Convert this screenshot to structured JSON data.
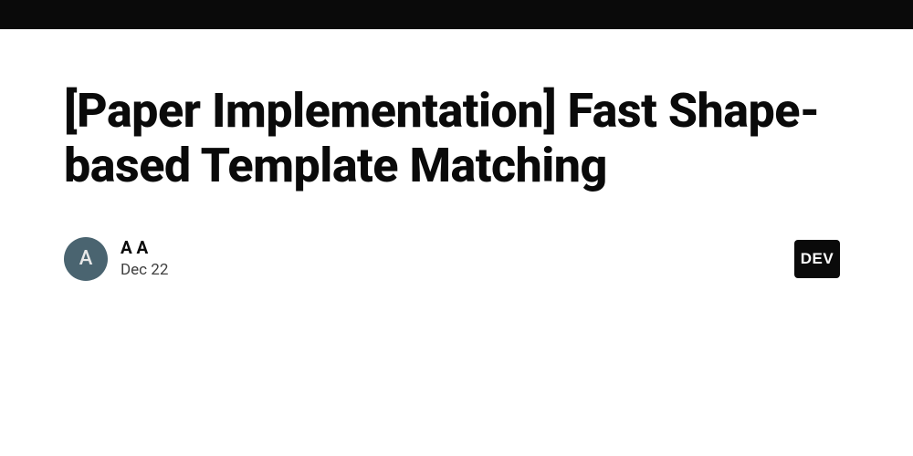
{
  "article": {
    "title": "[Paper Implementation] Fast Shape-based Template Matching"
  },
  "author": {
    "avatar_initial": "A",
    "name": "A A",
    "date": "Dec 22"
  },
  "brand": {
    "badge_text": "DEV"
  }
}
